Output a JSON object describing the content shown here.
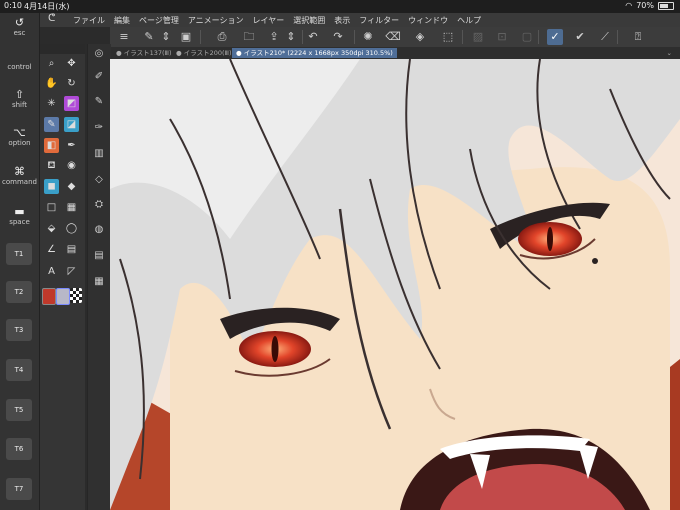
{
  "status": {
    "time": "0:10",
    "date": "4月14日(水)",
    "battery": "70%"
  },
  "edge_keys": {
    "esc": "esc",
    "control": "control",
    "shift": "shift",
    "option": "option",
    "command": "command",
    "space": "space",
    "t_keys": [
      "T1",
      "T2",
      "T3",
      "T4",
      "T5",
      "T6",
      "T7"
    ]
  },
  "menu": {
    "items": [
      "ファイル",
      "編集",
      "ページ管理",
      "アニメーション",
      "レイヤー",
      "選択範囲",
      "表示",
      "フィルター",
      "ウィンドウ",
      "ヘルプ"
    ]
  },
  "tabs": [
    {
      "label": "● イラスト137(Ⅲ)"
    },
    {
      "label": "● イラスト200(Ⅲ)"
    },
    {
      "label": "● イラスト210* (2224 x 1668px 350dpi 310.5%)"
    }
  ],
  "icons": {
    "tools": [
      "magnifier-icon",
      "move-icon",
      "hand-icon",
      "rotate-icon",
      "spark-icon",
      "gradient-icon",
      "brush-icon",
      "airbrush-icon",
      "eraser-icon",
      "pen-icon",
      "bucket-icon",
      "marker-icon",
      "square-icon",
      "fill-icon",
      "lasso-icon",
      "text-icon",
      "ruler-icon"
    ],
    "colors": {
      "main": "#c0392b",
      "sub": "#b8b8c8",
      "accent": "#4e6c92"
    }
  }
}
